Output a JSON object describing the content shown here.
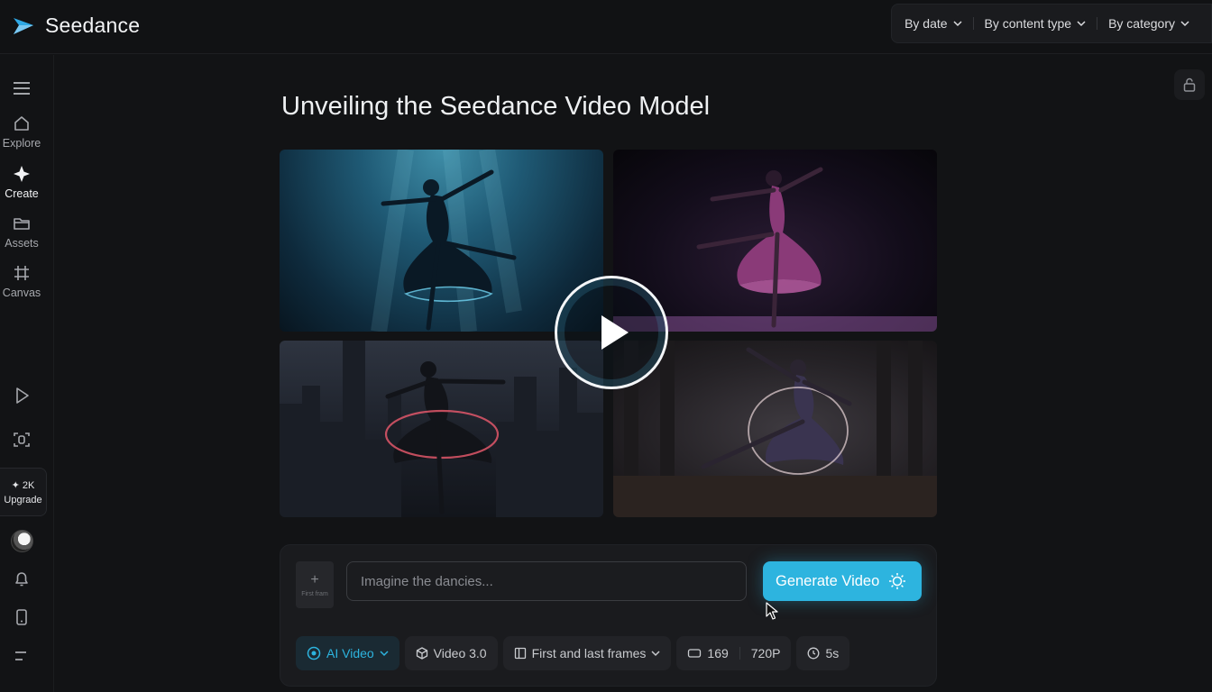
{
  "brand": {
    "name": "Seedance"
  },
  "filters": [
    {
      "label": "By date"
    },
    {
      "label": "By content type"
    },
    {
      "label": "By category"
    }
  ],
  "sidebar": {
    "items": [
      {
        "label": "Explore",
        "icon": "home-icon"
      },
      {
        "label": "Create",
        "icon": "sparkle-icon"
      },
      {
        "label": "Assets",
        "icon": "folder-icon"
      },
      {
        "label": "Canvas",
        "icon": "grid-icon"
      }
    ],
    "upgrade": {
      "credits": "✦ 2K",
      "label": "Upgrade"
    }
  },
  "main": {
    "title": "Unveiling the Seedance Video Model"
  },
  "composer": {
    "first_frame_label": "First fram",
    "prompt_placeholder": "Imagine the dancies...",
    "generate_label": "Generate Video",
    "options": {
      "mode": "AI Video",
      "model": "Video 3.0",
      "frames": "First and last frames",
      "ratio": "169",
      "resolution": "720P",
      "duration": "5s"
    }
  },
  "colors": {
    "accent": "#2db4df",
    "background": "#121315",
    "panel": "#1a1b1e"
  }
}
